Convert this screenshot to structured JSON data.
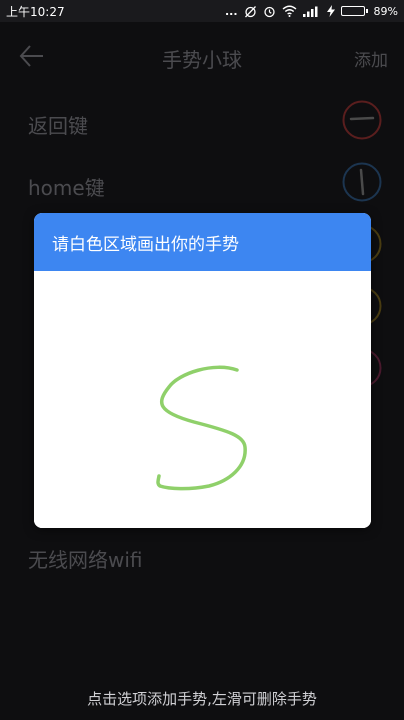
{
  "statusbar": {
    "time": "上午10:27",
    "more": "...",
    "battery_percent": "89%",
    "battery_level": 0.89,
    "icons": [
      "alarm-off-icon",
      "alarm-icon",
      "wifi-icon",
      "signal-icon",
      "charging-icon"
    ]
  },
  "header": {
    "title": "手势小球",
    "action_label": "添加",
    "back_icon": "back-arrow-icon"
  },
  "list": {
    "items": [
      {
        "label": "返回键",
        "gesture_color": "#c0392b"
      },
      {
        "label": "home键",
        "gesture_color": "#2f6fb0"
      },
      {
        "label": "",
        "gesture_color": "#c9a227"
      },
      {
        "label": "",
        "gesture_color": "#c9a227"
      },
      {
        "label": "",
        "gesture_color": "#b03a6a"
      },
      {
        "label": "",
        "gesture_color": ""
      },
      {
        "label": "",
        "gesture_color": ""
      },
      {
        "label": "无线网络wifi",
        "gesture_color": ""
      }
    ]
  },
  "dialog": {
    "title": "请白色区域画出你的手势",
    "stroke_color": "#8fd06a"
  },
  "hint": "点击选项添加手势,左滑可删除手势"
}
